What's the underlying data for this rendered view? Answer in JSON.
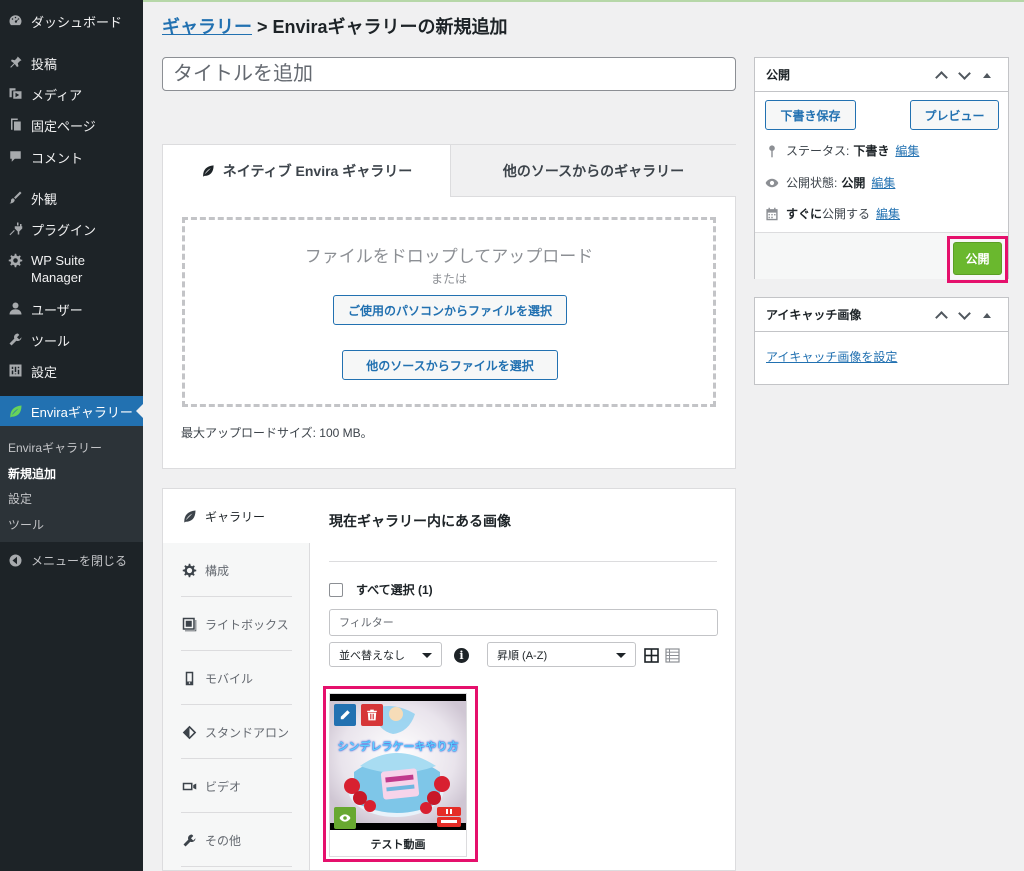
{
  "sidebar": {
    "items": [
      {
        "label": "ダッシュボード",
        "icon": "dashboard-icon"
      },
      {
        "label": "投稿",
        "icon": "pin-icon"
      },
      {
        "label": "メディア",
        "icon": "media-icon"
      },
      {
        "label": "固定ページ",
        "icon": "page-icon"
      },
      {
        "label": "コメント",
        "icon": "comment-icon"
      },
      {
        "label": "外観",
        "icon": "brush-icon"
      },
      {
        "label": "プラグイン",
        "icon": "plugin-icon"
      },
      {
        "label": "WP Suite Manager",
        "icon": "gear-icon"
      },
      {
        "label": "ユーザー",
        "icon": "user-icon"
      },
      {
        "label": "ツール",
        "icon": "wrench-icon"
      },
      {
        "label": "設定",
        "icon": "settings-icon"
      },
      {
        "label": "Enviraギャラリー",
        "icon": "envira-leaf-icon"
      }
    ],
    "submenu": [
      "Enviraギャラリー",
      "新規追加",
      "設定",
      "ツール"
    ],
    "collapse_label": "メニューを閉じる"
  },
  "header": {
    "breadcrumb_link": "ギャラリー",
    "breadcrumb_sep": " > ",
    "title": "Enviraギャラリーの新規追加"
  },
  "title_input": {
    "placeholder": "タイトルを追加",
    "value": ""
  },
  "upload": {
    "tab_native": "ネイティブ Envira ギャラリー",
    "tab_other": "他のソースからのギャラリー",
    "drop_title": "ファイルをドロップしてアップロード",
    "drop_or": "または",
    "btn_pc": "ご使用のパソコンからファイルを選択",
    "btn_other": "他のソースからファイルを選択",
    "max_size": "最大アップロードサイズ: 100 MB。"
  },
  "gallery": {
    "tabs": [
      "ギャラリー",
      "構成",
      "ライトボックス",
      "モバイル",
      "スタンドアロン",
      "ビデオ",
      "その他"
    ],
    "heading": "現在ギャラリー内にある画像",
    "select_all": "すべて選択 (1)",
    "filter_placeholder": "フィルター",
    "sort_value": "並べ替えなし",
    "order_value": "昇順 (A-Z)",
    "info_glyph": "i",
    "image": {
      "caption_text": "シンデレラケーキやり方",
      "title": "テスト動画"
    }
  },
  "publish": {
    "title": "公開",
    "save_draft": "下書き保存",
    "preview": "プレビュー",
    "status_label": "ステータス:",
    "status_value": "下書き",
    "visibility_label": "公開状態:",
    "visibility_value": "公開",
    "schedule_value": "すぐに",
    "schedule_label": "公開する",
    "edit_link": "編集",
    "publish_button": "公開"
  },
  "featured": {
    "title": "アイキャッチ画像",
    "link": "アイキャッチ画像を設定"
  },
  "colors": {
    "sidebar_bg": "#1d2327",
    "accent": "#2271b1",
    "publish_green": "#6ab82e",
    "highlight": "#e5106c"
  }
}
